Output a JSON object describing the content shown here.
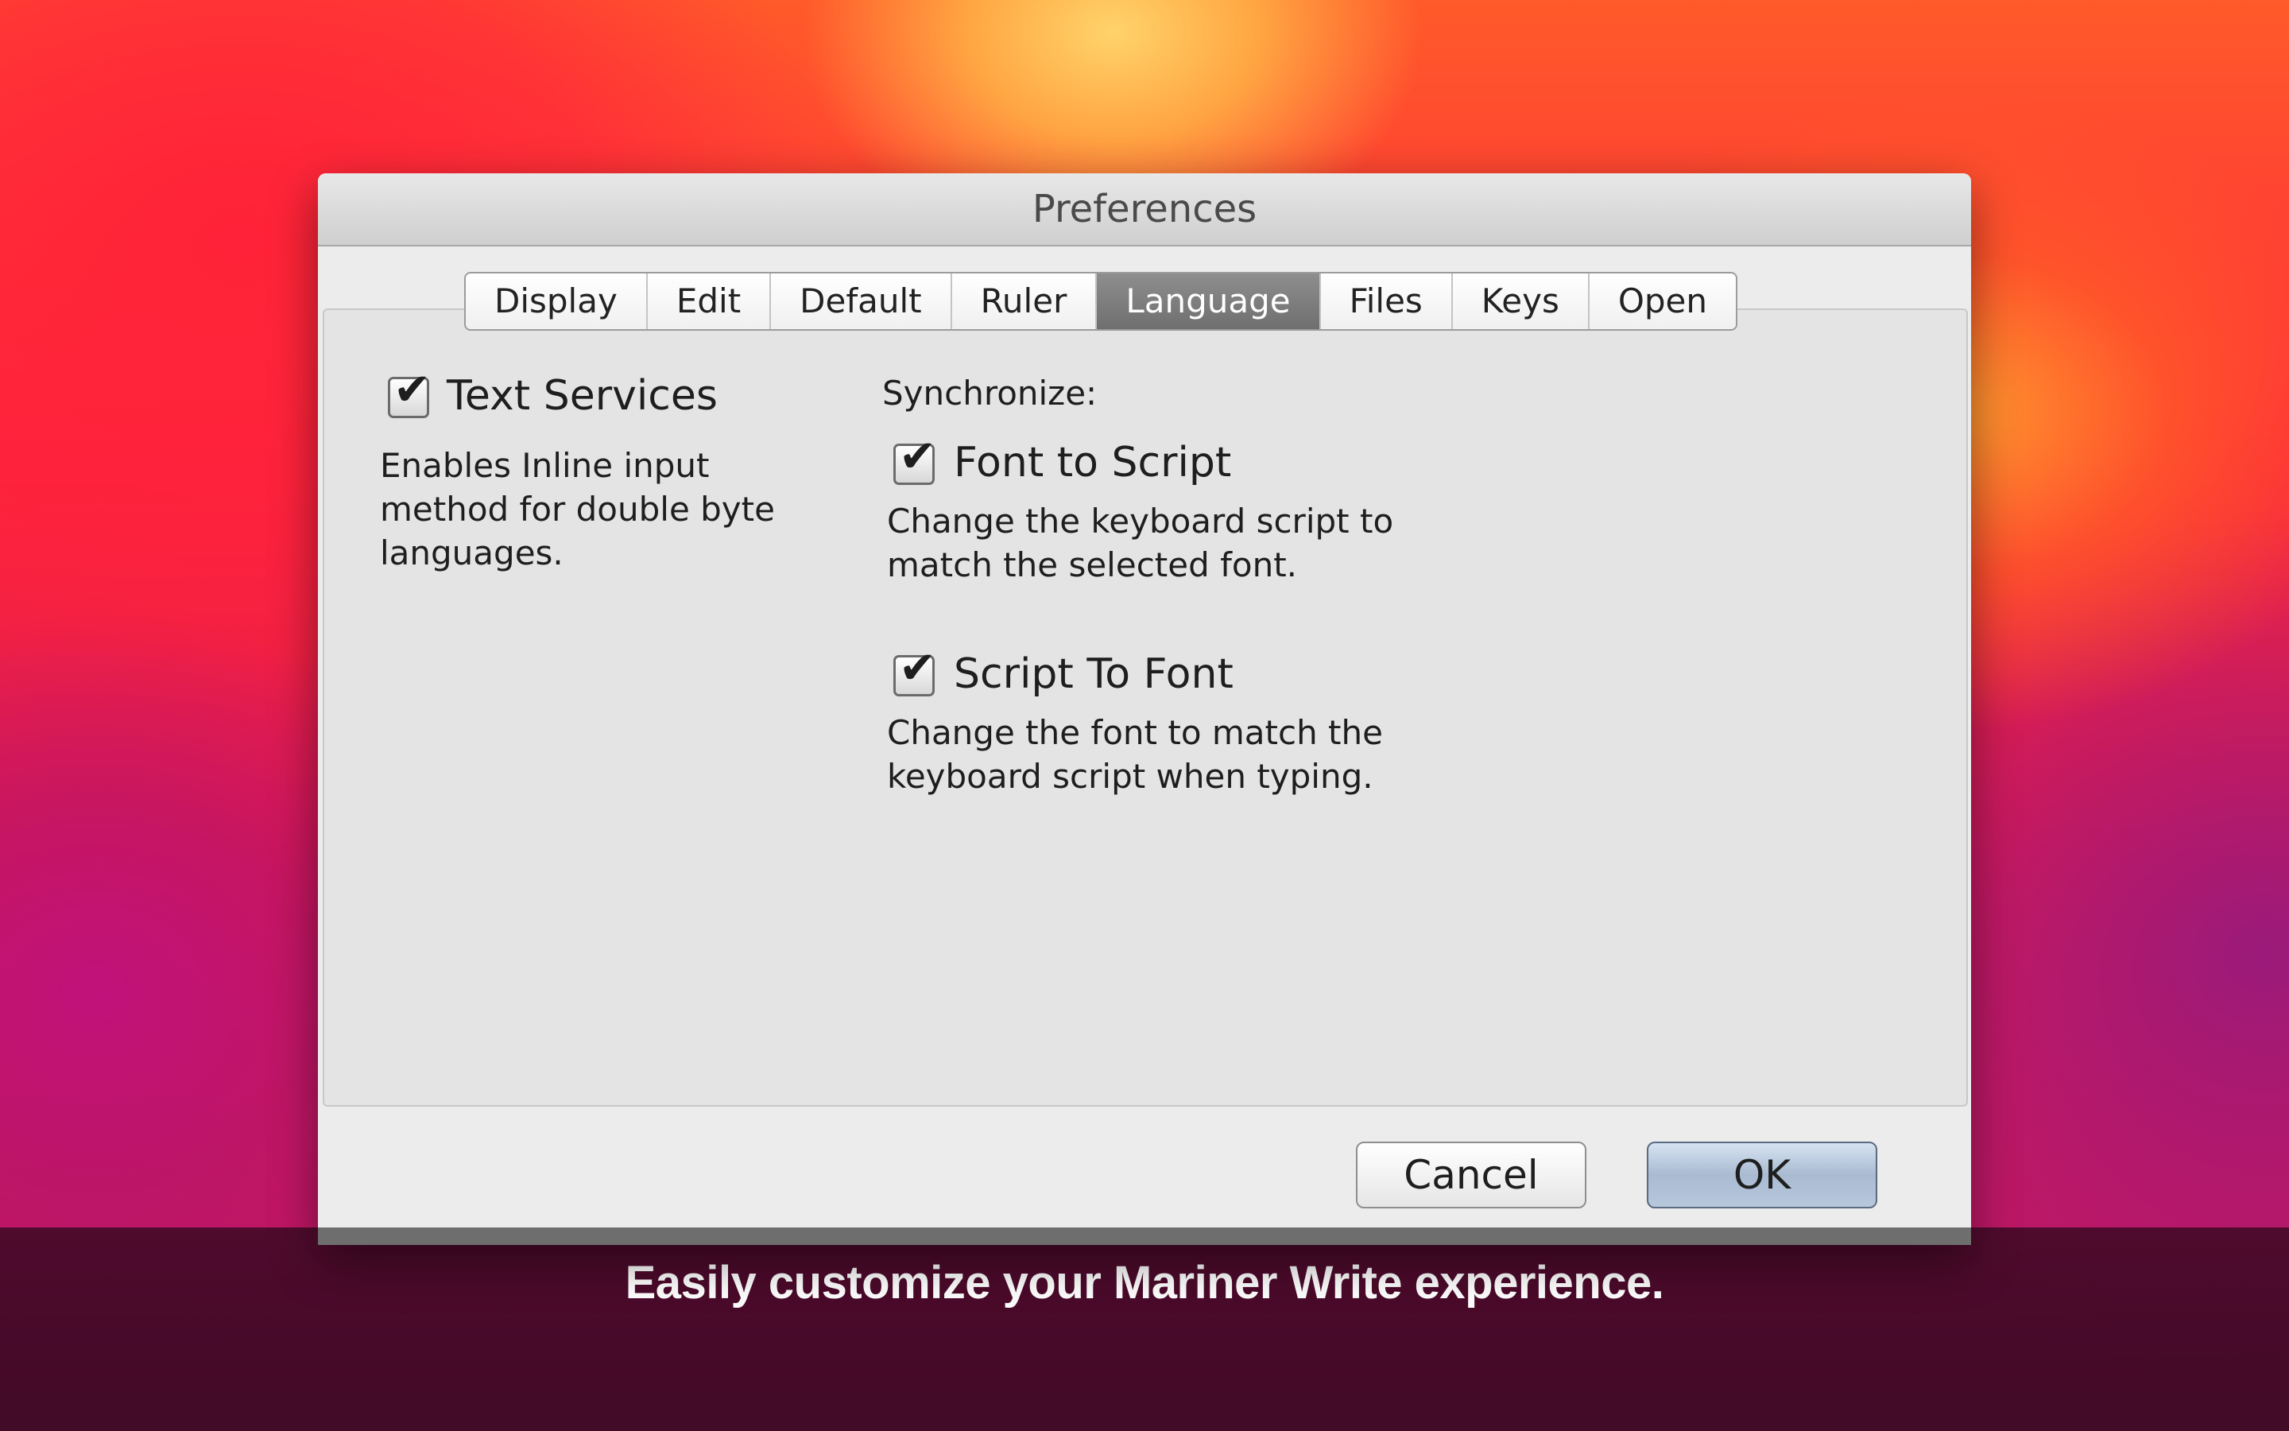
{
  "window": {
    "title": "Preferences"
  },
  "tabs": [
    {
      "label": "Display",
      "active": false
    },
    {
      "label": "Edit",
      "active": false
    },
    {
      "label": "Default",
      "active": false
    },
    {
      "label": "Ruler",
      "active": false
    },
    {
      "label": "Language",
      "active": true
    },
    {
      "label": "Files",
      "active": false
    },
    {
      "label": "Keys",
      "active": false
    },
    {
      "label": "Open",
      "active": false
    }
  ],
  "text_services": {
    "label": "Text Services",
    "checked": true,
    "description": [
      "Enables Inline input",
      "method for double byte",
      "languages."
    ]
  },
  "synchronize": {
    "label": "Synchronize:",
    "font_to_script": {
      "label": "Font to Script",
      "checked": true,
      "description": [
        "Change the keyboard script to",
        "match the selected font."
      ]
    },
    "script_to_font": {
      "label": "Script To Font",
      "checked": true,
      "description": [
        "Change the font to match the",
        "keyboard script when typing."
      ]
    }
  },
  "buttons": {
    "cancel": "Cancel",
    "ok": "OK"
  },
  "caption": "Easily customize your Mariner Write experience.",
  "checkmark_glyph": "✔"
}
